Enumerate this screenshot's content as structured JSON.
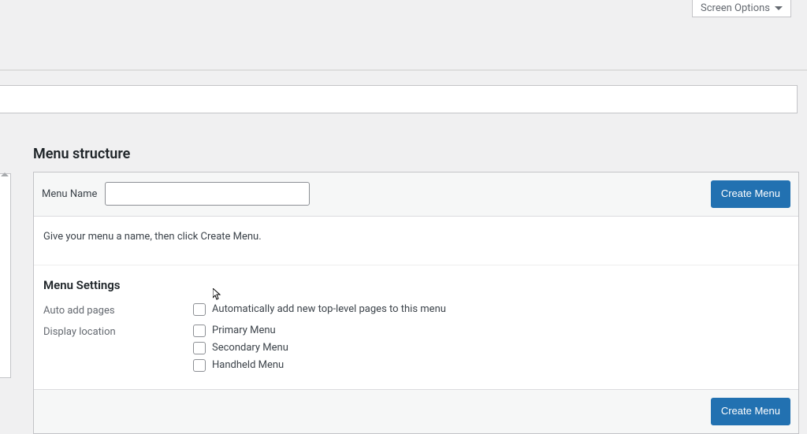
{
  "screen_options_label": "Screen Options",
  "section_title": "Menu structure",
  "menu_name": {
    "label": "Menu Name",
    "value": ""
  },
  "buttons": {
    "create_menu": "Create Menu"
  },
  "instruction_text": "Give your menu a name, then click Create Menu.",
  "menu_settings": {
    "title": "Menu Settings",
    "auto_add": {
      "label": "Auto add pages",
      "option": "Automatically add new top-level pages to this menu"
    },
    "display_location": {
      "label": "Display location",
      "options": [
        "Primary Menu",
        "Secondary Menu",
        "Handheld Menu"
      ]
    }
  }
}
